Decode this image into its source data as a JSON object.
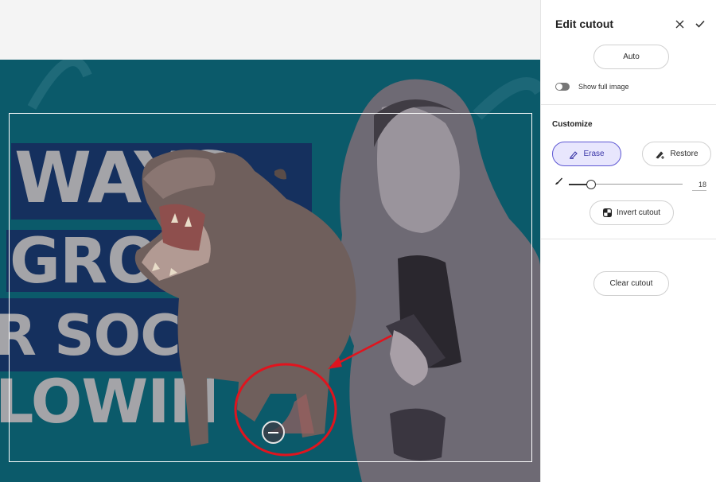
{
  "panel": {
    "title": "Edit cutout",
    "auto_label": "Auto",
    "show_full_image_label": "Show full image",
    "show_full_image_on": false,
    "customize_label": "Customize",
    "erase_label": "Erase",
    "restore_label": "Restore",
    "active_tool": "erase",
    "brush_size": "18",
    "invert_label": "Invert cutout",
    "clear_label": "Clear cutout"
  },
  "canvas": {
    "headline_lines": [
      "WAYS",
      "GRO",
      "R SOC",
      "LOWIN"
    ]
  },
  "colors": {
    "canvas_bg": "#0b5a6a",
    "accent": "#5d57d3",
    "annotation": "#e0141e"
  }
}
